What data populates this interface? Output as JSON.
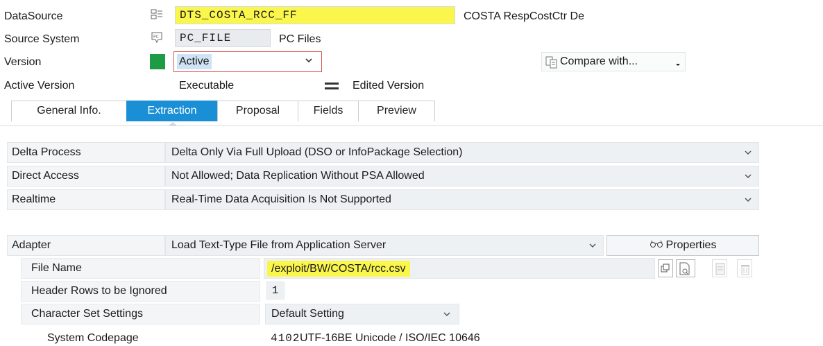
{
  "header": {
    "datasource_label": "DataSource",
    "datasource_value": "DTS_COSTA_RCC_FF",
    "datasource_desc": "COSTA RespCostCtr De",
    "source_system_label": "Source System",
    "source_system_value": "PC_FILE",
    "source_system_desc": "PC Files",
    "version_label": "Version",
    "version_value": "Active",
    "compare_button": "Compare with...",
    "active_version_label": "Active Version",
    "active_version_value": "Executable",
    "edited_version_label": "Edited Version",
    "status_color": "#1e9c45",
    "highlight_color": "#fbf64c",
    "accent_color": "#1a8fd6"
  },
  "tabs": [
    {
      "label": "General Info.",
      "active": false
    },
    {
      "label": "Extraction",
      "active": true
    },
    {
      "label": "Proposal",
      "active": false
    },
    {
      "label": "Fields",
      "active": false
    },
    {
      "label": "Preview",
      "active": false
    }
  ],
  "extraction": {
    "rows": [
      {
        "label": "Delta Process",
        "value": "Delta Only Via Full Upload (DSO or InfoPackage Selection)"
      },
      {
        "label": "Direct Access",
        "value": "Not Allowed; Data Replication Without PSA Allowed"
      },
      {
        "label": "Realtime",
        "value": "Real-Time Data Acquisition Is Not Supported"
      }
    ],
    "adapter_label": "Adapter",
    "adapter_value": "Load Text-Type File from Application Server",
    "properties_button": "Properties",
    "file_name_label": "File Name",
    "file_name_value": "/exploit/BW/COSTA/rcc.csv",
    "header_rows_label": "Header Rows to be Ignored",
    "header_rows_value": "1",
    "charset_label": "Character Set Settings",
    "charset_value": "Default Setting",
    "codepage_label": "System Codepage",
    "codepage_number": "4102",
    "codepage_desc": "UTF-16BE Unicode / ISO/IEC 10646"
  }
}
